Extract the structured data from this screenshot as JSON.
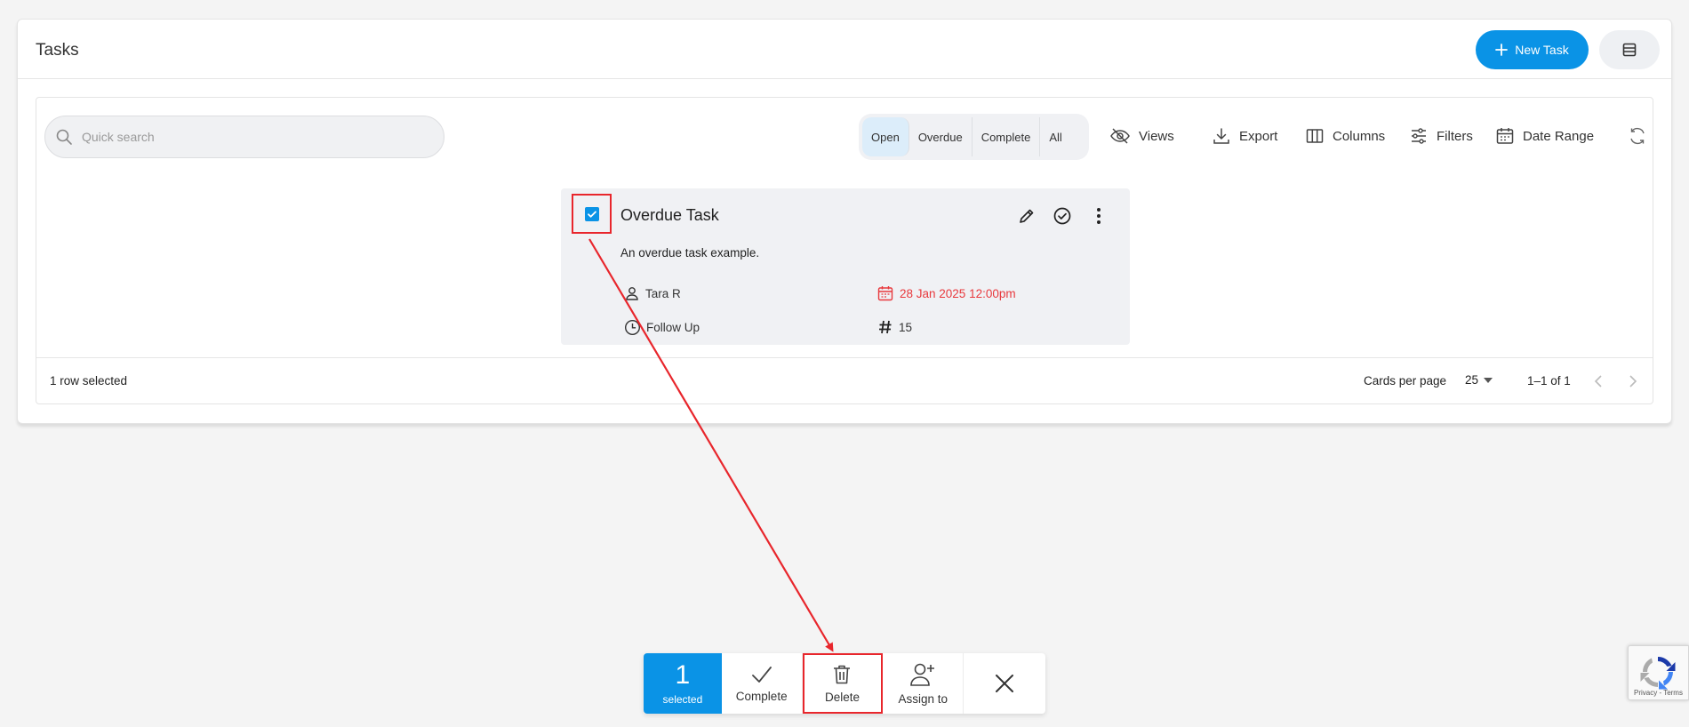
{
  "header": {
    "title": "Tasks",
    "new_task_label": "New Task"
  },
  "search": {
    "placeholder": "Quick search"
  },
  "status_tabs": [
    {
      "label": "Open",
      "active": true
    },
    {
      "label": "Overdue",
      "active": false
    },
    {
      "label": "Complete",
      "active": false
    },
    {
      "label": "All",
      "active": false
    }
  ],
  "toolbar": {
    "views": "Views",
    "export": "Export",
    "columns": "Columns",
    "filters": "Filters",
    "date_range": "Date Range"
  },
  "task_card": {
    "title": "Overdue Task",
    "description": "An overdue task example.",
    "assignee": "Tara R",
    "due": "28 Jan 2025 12:00pm",
    "type": "Follow Up",
    "number": "15",
    "checked": true
  },
  "footer": {
    "selection": "1 row selected",
    "cards_per_page_label": "Cards per page",
    "cards_per_page_value": "25",
    "range": "1–1 of 1"
  },
  "action_bar": {
    "count": "1",
    "selected_label": "selected",
    "complete": "Complete",
    "delete": "Delete",
    "assign": "Assign to"
  },
  "recaptcha": {
    "text": "Privacy - Terms"
  },
  "colors": {
    "accent": "#0a93e6",
    "danger": "#e8393d",
    "annotation": "#e8262c"
  }
}
